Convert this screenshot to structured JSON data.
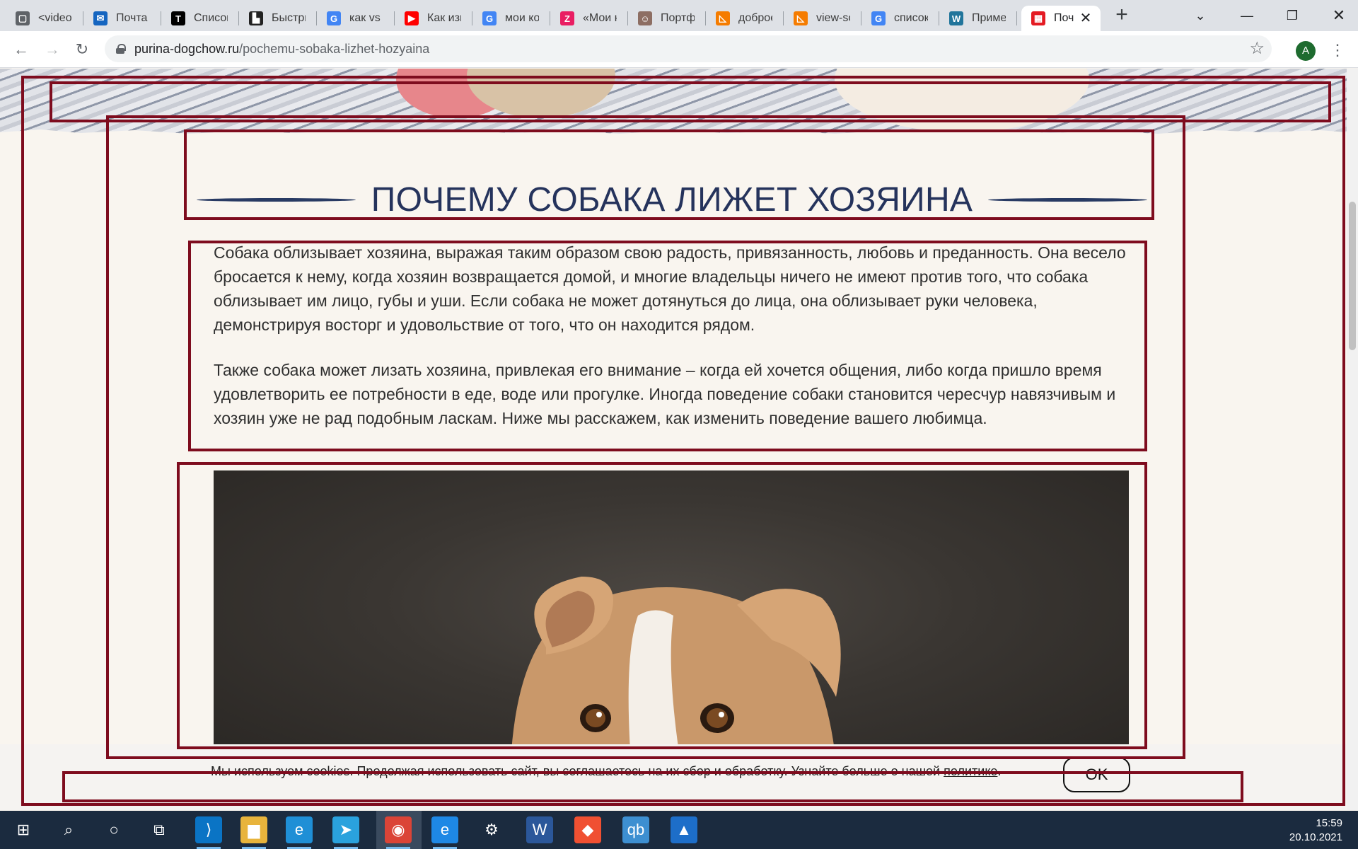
{
  "browser": {
    "tabs": [
      {
        "title": "<video>",
        "icon": "message-square-icon",
        "color": "#5f6368"
      },
      {
        "title": "Почта М",
        "icon": "mail-icon",
        "color": "#1565c0"
      },
      {
        "title": "Список",
        "icon": "tilda-icon",
        "color": "#000000"
      },
      {
        "title": "Быстры",
        "icon": "chart-icon",
        "color": "#222222"
      },
      {
        "title": "как vs c",
        "icon": "google-icon",
        "color": "#4285f4"
      },
      {
        "title": "Как изм",
        "icon": "youtube-icon",
        "color": "#ff0000"
      },
      {
        "title": "мои ко",
        "icon": "google-icon",
        "color": "#4285f4"
      },
      {
        "title": "«Мои к",
        "icon": "zen-icon",
        "color": "#e91e63"
      },
      {
        "title": "Портфо",
        "icon": "portfolio-icon",
        "color": "#8d6e63"
      },
      {
        "title": "доброе",
        "icon": "triangle-icon",
        "color": "#f57c00"
      },
      {
        "title": "view-so",
        "icon": "triangle-icon",
        "color": "#f57c00"
      },
      {
        "title": "список",
        "icon": "google-icon",
        "color": "#4285f4"
      },
      {
        "title": "Пример",
        "icon": "wordpress-icon",
        "color": "#21759b"
      },
      {
        "title": "Поч",
        "icon": "purina-icon",
        "color": "#e41b23",
        "active": true
      }
    ],
    "url_host": "purina-dogchow.ru",
    "url_path": "/pochemu-sobaka-lizhet-hozyaina",
    "profile_initial": "A"
  },
  "article": {
    "title": "ПОЧЕМУ СОБАКА ЛИЖЕТ ХОЗЯИНА",
    "paragraphs": [
      "Собака облизывает хозяина, выражая таким образом свою радость, привязанность, любовь и преданность. Она весело бросается к нему, когда хозяин возвращается домой, и многие владельцы ничего не имеют против того, что собака облизывает им лицо, губы и уши. Если собака не может дотянуться до лица, она облизывает руки человека, демонстрируя восторг и удовольствие от того, что он находится рядом.",
      "Также собака может лизать хозяина, привлекая его внимание – когда ей хочется общения, либо когда пришло время удовлетворить ее потребности в еде, воде или прогулке. Иногда поведение собаки становится чересчур навязчивым и хозяин уже не рад подобным ласкам. Ниже мы расскажем, как изменить поведение вашего любимца."
    ]
  },
  "cookie": {
    "text": "Мы используем cookies. Продолжая использовать сайт, вы соглашаетесь на их сбор и обработку. Узнайте больше о нашей ",
    "link": "политике",
    "end": ".",
    "button": "OK"
  },
  "taskbar": {
    "apps": [
      "windows-start-icon",
      "search-icon",
      "cortana-icon",
      "task-view-icon",
      "vscode-icon",
      "file-explorer-icon",
      "edge-icon",
      "telegram-icon",
      "chrome-icon",
      "internet-explorer-icon",
      "settings-icon",
      "word-icon",
      "git-icon",
      "qbittorrent-icon",
      "photos-icon"
    ],
    "time": "15:59",
    "date": "20.10.2021"
  },
  "colors": {
    "title": "#25335c",
    "highlight_box": "#7e0c1e",
    "taskbar": "#1b2b3f"
  }
}
